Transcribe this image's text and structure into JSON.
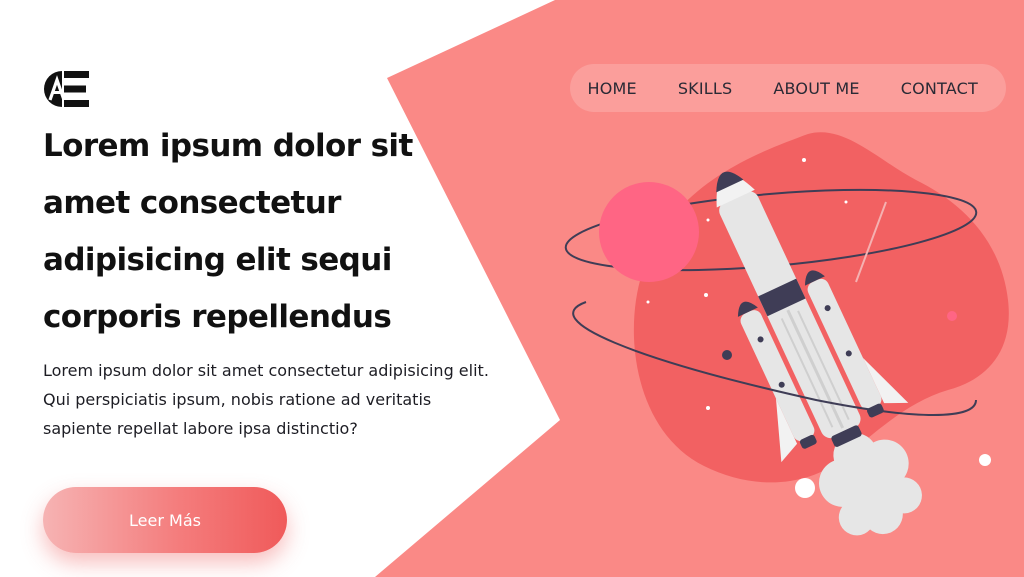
{
  "brand": {
    "logo_text": "AE"
  },
  "nav": {
    "items": [
      {
        "label": "HOME"
      },
      {
        "label": "SKILLS"
      },
      {
        "label": "ABOUT ME"
      },
      {
        "label": "CONTACT"
      }
    ]
  },
  "hero": {
    "title": "Lorem ipsum dolor sit amet consectetur adipisicing elit sequi corporis repellendus",
    "description": "Lorem ipsum dolor sit amet consectetur adipisicing elit. Qui perspiciatis ipsum, nobis ratione ad veritatis sapiente repellat labore ipsa distinctio?",
    "cta_label": "Leer Más"
  },
  "colors": {
    "background": "#ffffff",
    "accent_coral": "#fa8986",
    "blob": "#f26162",
    "planet": "#ff6584",
    "ink": "#3f3d56"
  },
  "icons": {
    "logo": "ae-monogram-logo",
    "illustration": "rocket-launch-illustration"
  }
}
